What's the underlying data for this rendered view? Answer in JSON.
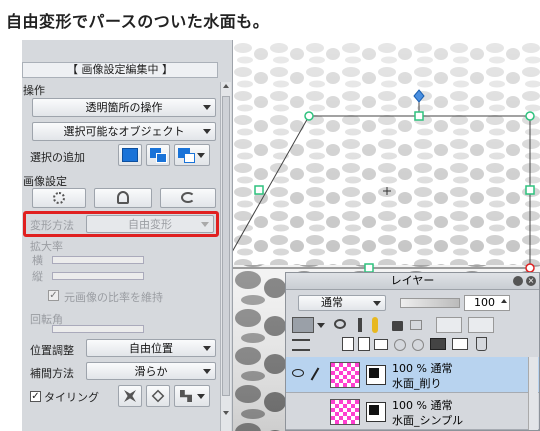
{
  "heading": "自由変形でパースのついた水面も。",
  "tool_panel": {
    "title": "【 画像設定編集中 】",
    "section_operation": "操作",
    "transparent_ops": "透明箇所の操作",
    "selectable_objects": "選択可能なオブジェクト",
    "add_selection_label": "選択の追加",
    "section_image_settings": "画像設定",
    "transform_method_label": "変形方法",
    "transform_method_value": "自由変形",
    "scale_label": "拡大率",
    "width_label": "横",
    "height_label": "縦",
    "keep_ratio_label": "元画像の比率を維持",
    "rotation_label": "回転角",
    "position_label": "位置調整",
    "position_value": "自由位置",
    "interpolation_label": "補間方法",
    "interpolation_value": "滑らか",
    "tiling_label": "タイリング"
  },
  "layer_panel": {
    "title": "レイヤー",
    "blend_mode": "通常",
    "opacity": "100",
    "layers": [
      {
        "line1": "100 %  通常",
        "line2": "水面_削り",
        "selected": true
      },
      {
        "line1": "100 %  通常",
        "line2": "水面_シンプル",
        "selected": false
      }
    ]
  },
  "colors": {
    "highlight": "#e02020",
    "accent_blue": "#1a73d8",
    "handle_green": "#2ec27e",
    "layer_thumb_pink": "#ff3fd0",
    "selected_layer": "#b8d3ef"
  }
}
